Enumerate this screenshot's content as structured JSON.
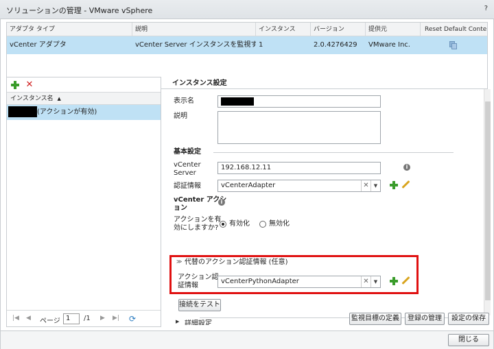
{
  "window": {
    "title": "ソリューションの管理 - VMware vSphere",
    "help": "?"
  },
  "adapters": {
    "columns": [
      "アダプタ タイプ",
      "説明",
      "インスタンス",
      "バージョン",
      "提供元",
      "Reset Default Content"
    ],
    "rows": [
      {
        "type": "vCenter アダプタ",
        "desc": "vCenter Server インスタンスを監視する...",
        "instances": "1",
        "version": "2.0.4276429",
        "vendor": "VMware Inc."
      }
    ]
  },
  "instances": {
    "column": "インスタンス名",
    "items": [
      {
        "suffix": "(アクションが有効)"
      }
    ]
  },
  "pager": {
    "page_label": "ページ",
    "page_value": "1",
    "total": "/1"
  },
  "settings": {
    "title": "インスタンス設定",
    "display_name_label": "表示名",
    "description_label": "説明",
    "basic_title": "基本設定",
    "vcenter_server_label_1": "vCenter",
    "vcenter_server_label_2": "Server",
    "vcenter_server_value": "192.168.12.11",
    "credential_label": "認証情報",
    "credential_value": "vCenterAdapter",
    "vcenter_action_label_1": "vCenter アクシ",
    "vcenter_action_label_2": "ョン",
    "enable_action_label_1": "アクションを有",
    "enable_action_label_2": "効にしますか?",
    "enable_label": "有効化",
    "disable_label": "無効化",
    "alt_cred_title": "代替のアクション認証情報 (任意)",
    "action_cred_label_1": "アクション認",
    "action_cred_label_2": "証情報",
    "action_cred_value": "vCenterPythonAdapter",
    "test_button": "接続をテスト",
    "advanced_label": "詳細設定"
  },
  "buttons": {
    "define_targets": "監視目標の定義",
    "manage_registration": "登録の管理",
    "save_settings": "設定の保存",
    "close": "閉じる"
  }
}
